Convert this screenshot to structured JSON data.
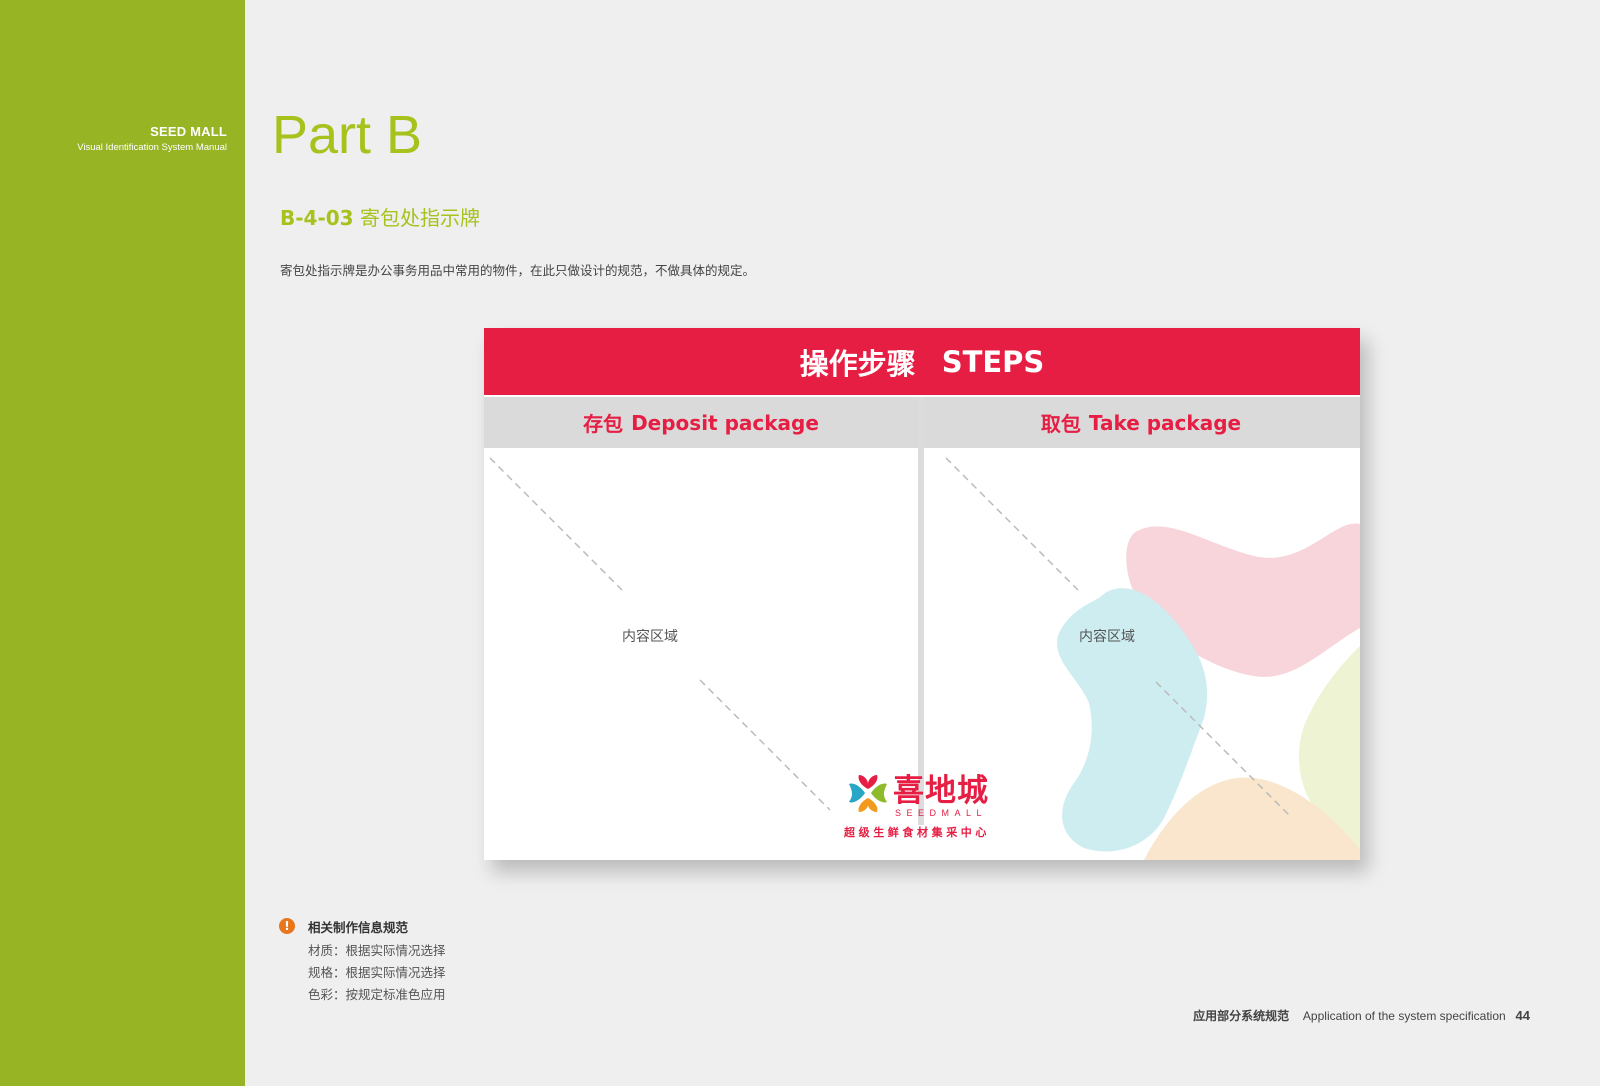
{
  "sidebar": {
    "brand_name": "SEED MALL",
    "brand_subtitle": "Visual Identification System Manual",
    "color": "#97b424"
  },
  "page": {
    "part_title": "Part B",
    "section_code": "B-4-03",
    "section_title": "寄包处指示牌",
    "description": "寄包处指示牌是办公事务用品中常用的物件，在此只做设计的规范，不做具体的规定。",
    "accent_color": "#a6c21c"
  },
  "sign": {
    "header_cn": "操作步骤",
    "header_en": "STEPS",
    "deposit_cn": "存包",
    "deposit_en": "Deposit package",
    "take_cn": "取包",
    "take_en": "Take package",
    "content_label_left": "内容区域",
    "content_label_right": "内容区域",
    "primary_color": "#e61e43"
  },
  "logo": {
    "name_cn": "喜地城",
    "name_en": "SEEDMALL",
    "tagline": "超级生鲜食材集采中心"
  },
  "notes": {
    "icon": "exclamation-icon",
    "title": "相关制作信息规范",
    "material": "材质：根据实际情况选择",
    "spec": "规格：根据实际情况选择",
    "color": "色彩：按规定标准色应用"
  },
  "footer": {
    "label_cn": "应用部分系统规范",
    "label_en": "Application of the  system specification",
    "page_number": "44"
  }
}
